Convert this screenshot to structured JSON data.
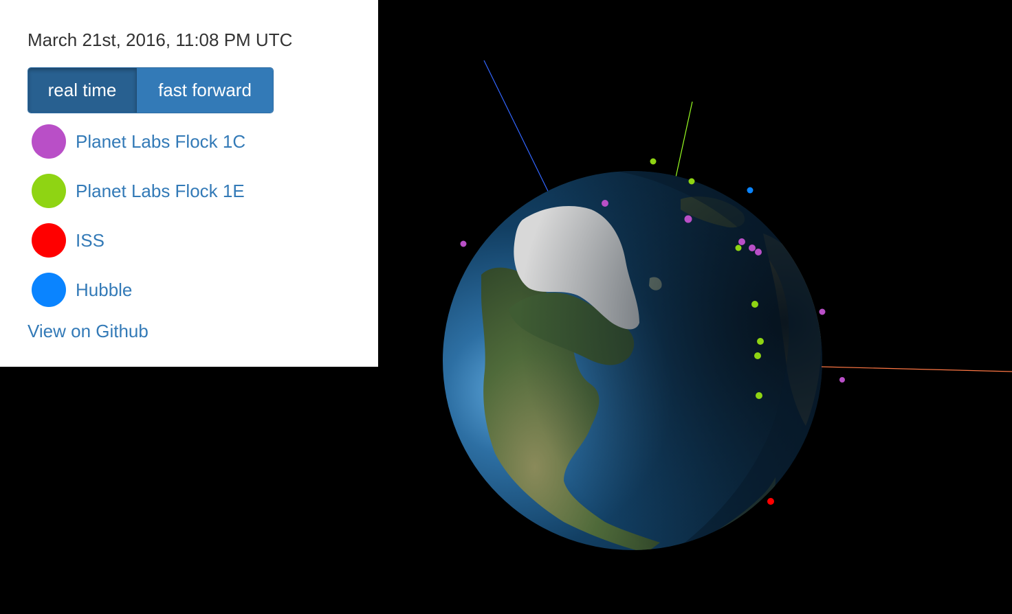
{
  "panel": {
    "timestamp": "March 21st, 2016, 11:08 PM UTC",
    "modes": {
      "real_time_label": "real time",
      "fast_forward_label": "fast forward",
      "active": "real time"
    },
    "legend": [
      {
        "label": "Planet Labs Flock 1C",
        "color": "#b94fc7"
      },
      {
        "label": "Planet Labs Flock 1E",
        "color": "#8fd413"
      },
      {
        "label": "ISS",
        "color": "#ff0000"
      },
      {
        "label": "Hubble",
        "color": "#0a84ff"
      }
    ],
    "github_link": "View on Github"
  },
  "scene": {
    "background_color": "#000000",
    "ocean_color": "#0d3a5c",
    "night_side_color": "#071a2a",
    "ice_color": "#d8d8d8",
    "axis_colors": {
      "x_axis": "#ff7744",
      "y_axis": "#99ff22",
      "z_axis": "#3366ff"
    }
  }
}
